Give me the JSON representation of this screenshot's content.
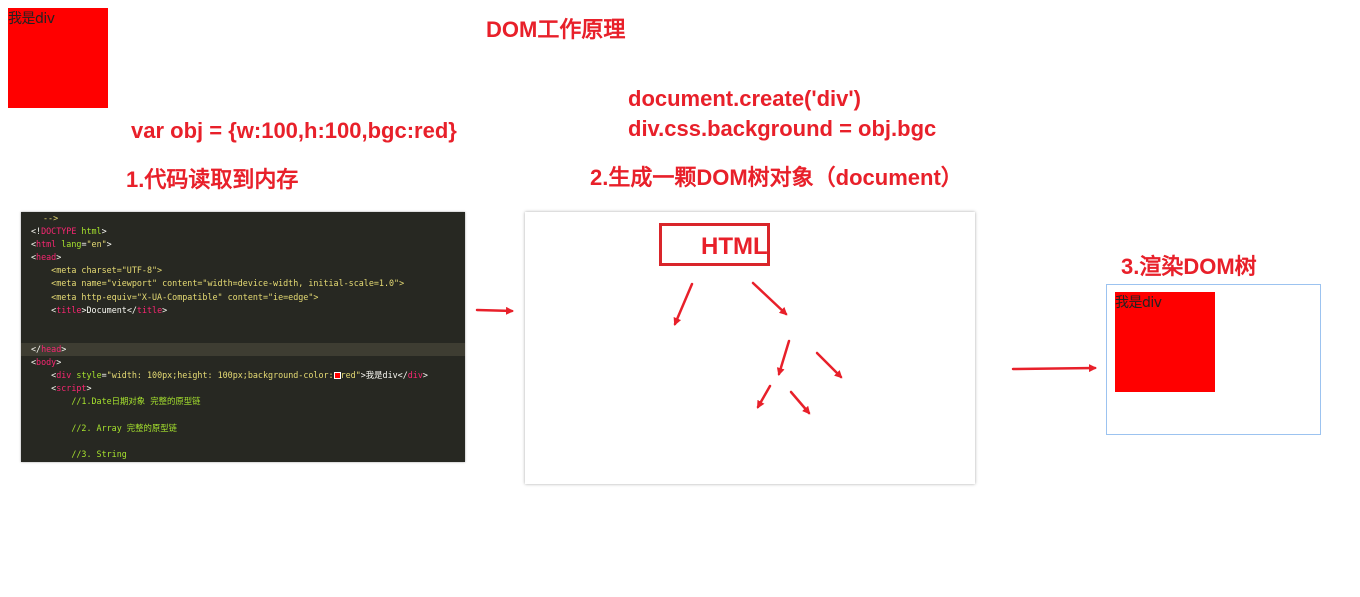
{
  "title": "DOM工作原理",
  "top_div": {
    "text": "我是div",
    "color": "#ff0000"
  },
  "code_snippet": {
    "line1": "document.create('div')",
    "line2": "div.css.background = obj.bgc"
  },
  "var_decl": "var obj = {w:100,h:100,bgc:red}",
  "steps": {
    "step1": "1.代码读取到内存",
    "step2": "2.生成一颗DOM树对象（document）",
    "step3": "3.渲染DOM树"
  },
  "tree_root": "HTML",
  "rendered_div": {
    "text": "我是div",
    "color": "#ff0000"
  },
  "editor": {
    "l0": "-->",
    "l1a": "<!",
    "l1b": "DOCTYPE",
    "l1c": " html",
    "l1d": ">",
    "l2a": "<",
    "l2b": "html",
    "l2c": " lang",
    "l2d": "=",
    "l2e": "\"en\"",
    "l2f": ">",
    "l3a": "<",
    "l3b": "head",
    "l3c": ">",
    "l4": "    <meta charset=\"UTF-8\">",
    "l5": "    <meta name=\"viewport\" content=\"width=device-width, initial-scale=1.0\">",
    "l6": "    <meta http-equiv=\"X-UA-Compatible\" content=\"ie=edge\">",
    "l7a": "    <",
    "l7b": "title",
    "l7c": ">Document</",
    "l7d": "title",
    "l7e": ">",
    "l10a": "</",
    "l10b": "head",
    "l10c": ">",
    "l11a": "<",
    "l11b": "body",
    "l11c": ">",
    "l12a": "    <",
    "l12b": "div",
    "l12c": " style",
    "l12d": "=",
    "l12e": "\"width: 100px;height: 100px;background-color:",
    "l12f": "red\"",
    "l12g": ">我是div</",
    "l12h": "div",
    "l12i": ">",
    "l13a": "    <",
    "l13b": "script",
    "l13c": ">",
    "l14": "        //1.Date日期对象 完整的原型链",
    "l16": "        //2. Array 完整的原型链",
    "l18": "        //3. String"
  },
  "colors": {
    "accent": "#e8202a",
    "editor_bg": "#272822",
    "window_border": "#9cc3f0"
  }
}
